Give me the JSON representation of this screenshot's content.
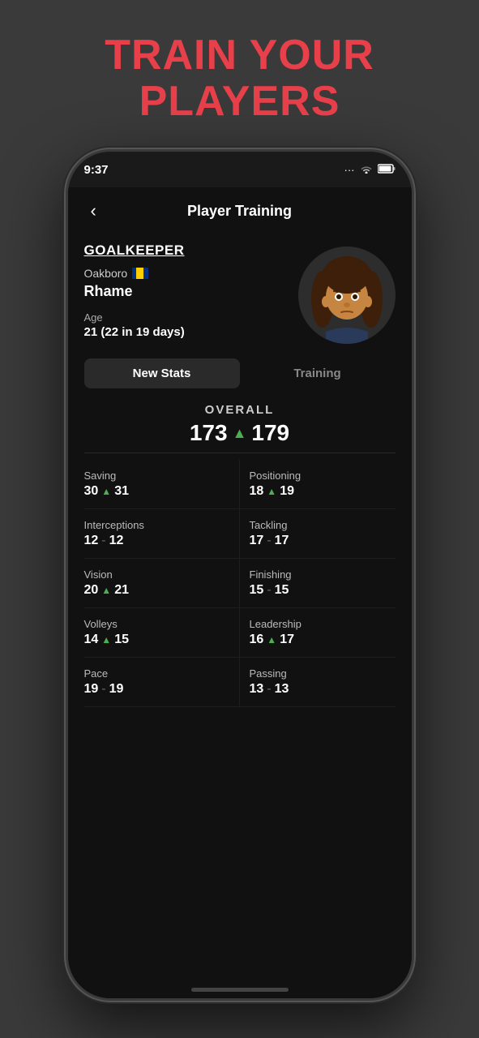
{
  "hero": {
    "line1": "TRAIN YOUR",
    "line2": "PLAYERS"
  },
  "status_bar": {
    "time": "9:37",
    "signal": "···",
    "wifi": "▾",
    "battery": "▮"
  },
  "nav": {
    "back_label": "‹",
    "title": "Player Training"
  },
  "player": {
    "position": "GOALKEEPER",
    "club": "Oakboro",
    "name": "Rhame",
    "age_label": "Age",
    "age_value": "21 (22 in 19 days)"
  },
  "tabs": {
    "active": "New Stats",
    "inactive": "Training"
  },
  "overall": {
    "label": "OVERALL",
    "old_value": "173",
    "new_value": "179"
  },
  "stats": [
    {
      "name": "Saving",
      "old": "30",
      "new": "31",
      "arrow": true,
      "separator": false
    },
    {
      "name": "Positioning",
      "old": "18",
      "new": "19",
      "arrow": true,
      "separator": false
    },
    {
      "name": "Interceptions",
      "old": "12",
      "new": "12",
      "arrow": false,
      "separator": true
    },
    {
      "name": "Tackling",
      "old": "17",
      "new": "17",
      "arrow": false,
      "separator": true
    },
    {
      "name": "Vision",
      "old": "20",
      "new": "21",
      "arrow": true,
      "separator": false
    },
    {
      "name": "Finishing",
      "old": "15",
      "new": "15",
      "arrow": false,
      "separator": true
    },
    {
      "name": "Volleys",
      "old": "14",
      "new": "15",
      "arrow": true,
      "separator": false
    },
    {
      "name": "Leadership",
      "old": "16",
      "new": "17",
      "arrow": true,
      "separator": false
    },
    {
      "name": "Pace",
      "old": "19",
      "new": "19",
      "arrow": false,
      "separator": true
    },
    {
      "name": "Passing",
      "old": "13",
      "new": "13",
      "arrow": false,
      "separator": true
    }
  ]
}
